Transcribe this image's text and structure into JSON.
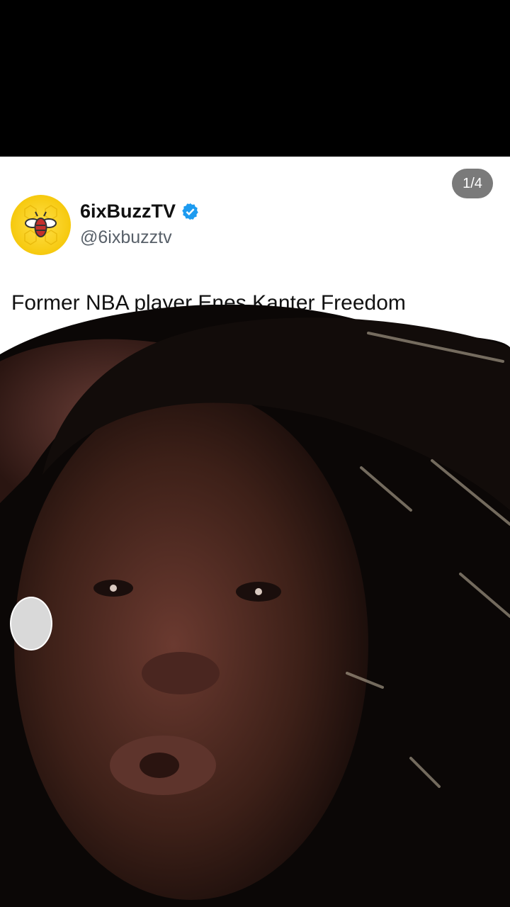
{
  "media_counter": "1/4",
  "account": {
    "name": "6ixBuzzTV",
    "handle": "@6ixbuzztv",
    "avatar_icon": "bee-logo-icon",
    "verified_icon": "verified-badge-icon"
  },
  "tweet": {
    "text": "Former NBA player Enes Kanter Freedom"
  },
  "colors": {
    "verified_blue": "#1d9bf0",
    "avatar_yellow": "#f6c90e",
    "counter_bg": "#7a7a7a"
  }
}
